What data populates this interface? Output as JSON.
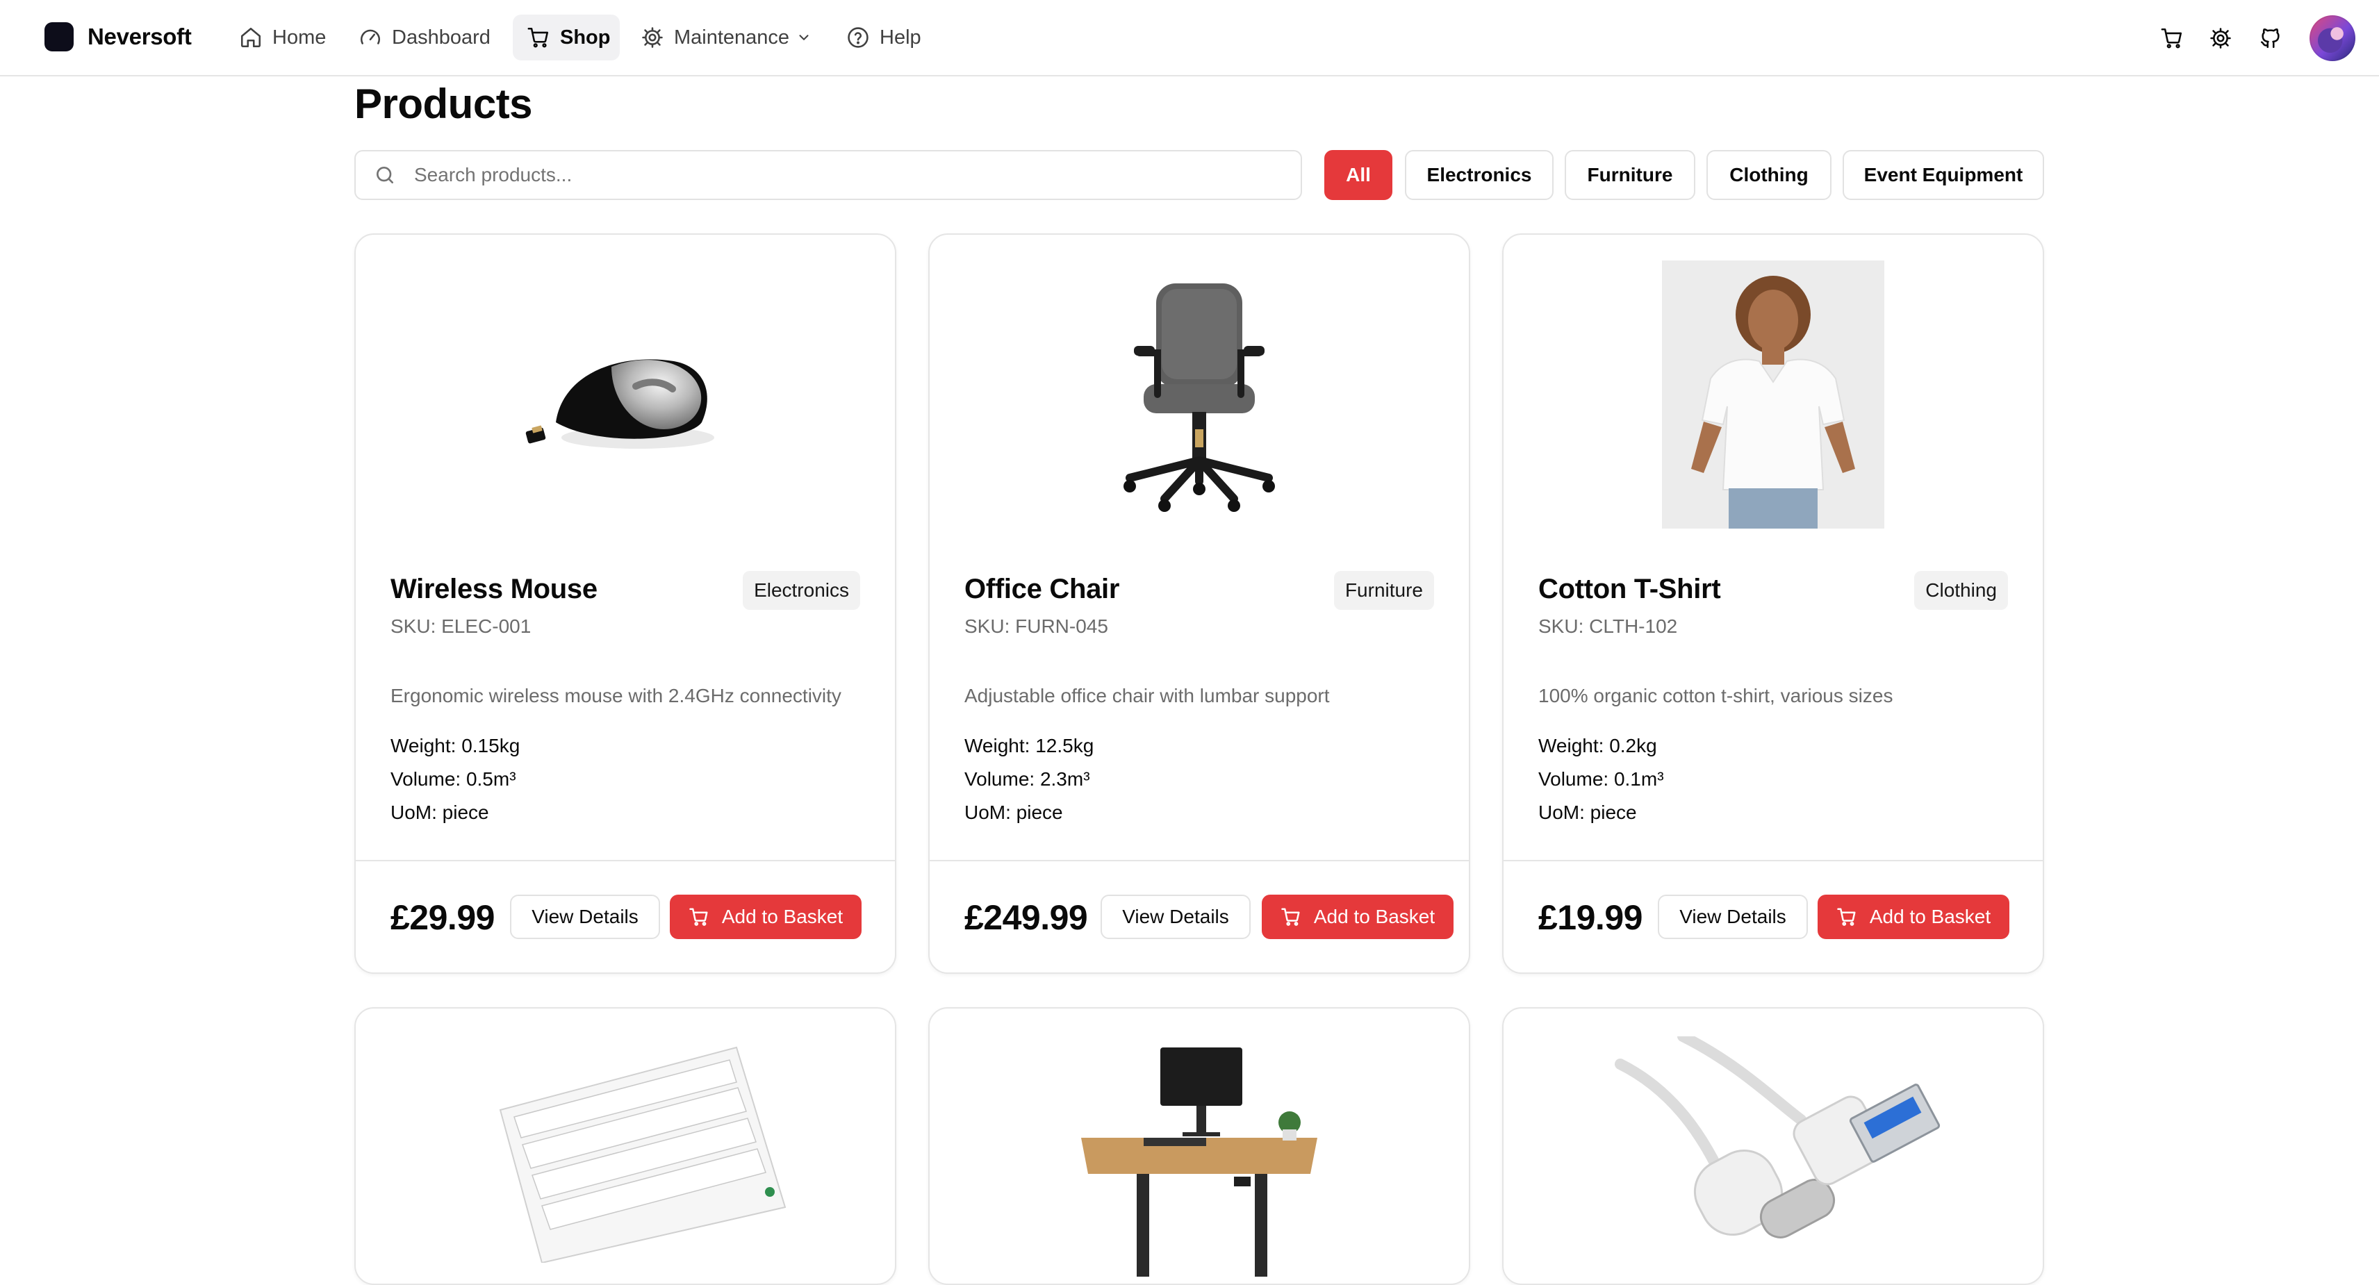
{
  "brand": {
    "name": "Neversoft"
  },
  "nav": {
    "home": "Home",
    "dashboard": "Dashboard",
    "shop": "Shop",
    "maintenance": "Maintenance",
    "help": "Help"
  },
  "page": {
    "title": "Products",
    "search_placeholder": "Search products..."
  },
  "filters": [
    "All",
    "Electronics",
    "Furniture",
    "Clothing",
    "Event Equipment"
  ],
  "active_filter": "All",
  "labels": {
    "view_details": "View Details",
    "add_to_basket": "Add to Basket"
  },
  "products": [
    {
      "name": "Wireless Mouse",
      "category": "Electronics",
      "sku": "SKU: ELEC-001",
      "description": "Ergonomic wireless mouse with 2.4GHz connectivity",
      "weight": "Weight: 0.15kg",
      "volume": "Volume: 0.5m³",
      "uom": "UoM: piece",
      "price": "£29.99",
      "image_icon": "mouse-image"
    },
    {
      "name": "Office Chair",
      "category": "Furniture",
      "sku": "SKU: FURN-045",
      "description": "Adjustable office chair with lumbar support",
      "weight": "Weight: 12.5kg",
      "volume": "Volume: 2.3m³",
      "uom": "UoM: piece",
      "price": "£249.99",
      "image_icon": "office-chair-image"
    },
    {
      "name": "Cotton T-Shirt",
      "category": "Clothing",
      "sku": "SKU: CLTH-102",
      "description": "100% organic cotton t-shirt, various sizes",
      "weight": "Weight: 0.2kg",
      "volume": "Volume: 0.1m³",
      "uom": "UoM: piece",
      "price": "£19.99",
      "image_icon": "t-shirt-image"
    }
  ],
  "products_row2_images": [
    "keyboard-image",
    "standing-desk-image",
    "usb-cable-image"
  ],
  "colors": {
    "accent": "#e5393b",
    "text": "#0a0a0a",
    "muted": "#6b6b6b",
    "border": "#e5e5e5"
  }
}
